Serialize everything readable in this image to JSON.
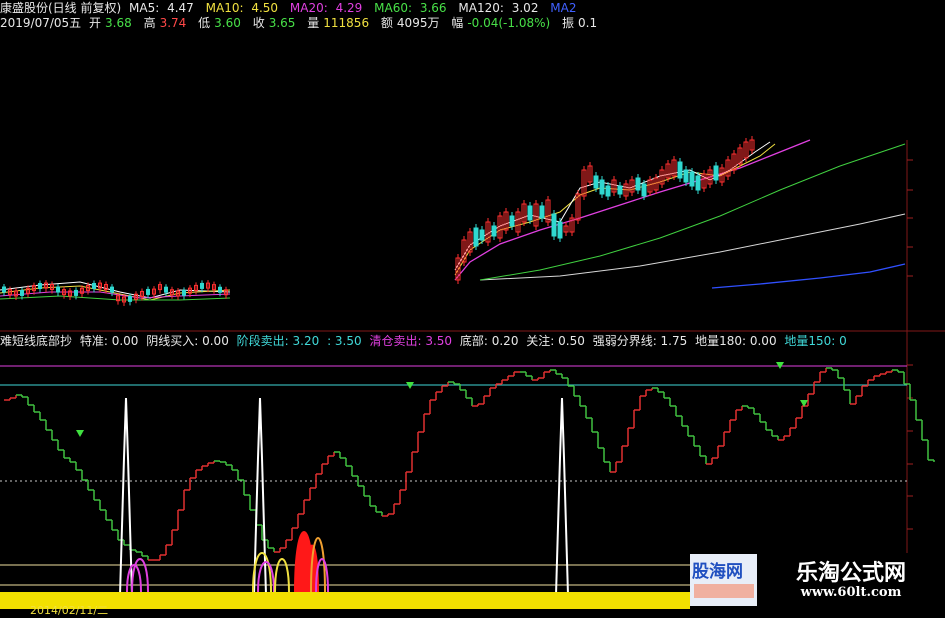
{
  "header": {
    "stock": "康盛股份(日线 前复权)",
    "ma5_label": "MA5:",
    "ma5": "4.47",
    "ma10_label": "MA10:",
    "ma10": "4.50",
    "ma20_label": "MA20:",
    "ma20": "4.29",
    "ma60_label": "MA60:",
    "ma60": "3.66",
    "ma120_label": "MA120:",
    "ma120": "3.02",
    "ma_more": "MA2",
    "date": "2019/07/05五",
    "open_label": "开",
    "open": "3.68",
    "high_label": "高",
    "high": "3.74",
    "low_label": "低",
    "low": "3.60",
    "close_label": "收",
    "close": "3.65",
    "vol_label": "量",
    "vol": "111856",
    "amount_label": "额",
    "amount": "4095万",
    "change_label": "幅",
    "change": "-0.04(-1.08%)",
    "amp_label": "振",
    "amp": "0.1"
  },
  "indicator": {
    "name": "难短线底部抄",
    "t1": "特准: 0.00",
    "t2": "阴线买入: 0.00",
    "t3a": "阶段卖出: 3.20",
    "t3b": ": 3.50",
    "t4": "清仓卖出: 3.50",
    "t5": "底部: 0.20",
    "t6": "关注: 0.50",
    "t7": "强弱分界线: 1.75",
    "t8": "地量180: 0.00",
    "t9": "地量150: 0"
  },
  "footer": {
    "date_label": "2014/02/11/二"
  },
  "watermark": {
    "title": "乐淘公式网",
    "url": "www.60lt.com",
    "logo": "股海网"
  },
  "colors": {
    "bg": "#000000",
    "up": "#ff3030",
    "down": "#30d8d0",
    "ma5": "#ffffff",
    "ma10": "#f0e040",
    "ma20": "#e040e0",
    "ma60": "#40d040",
    "ma120": "#d8d8d8",
    "ma_blue": "#4060ff"
  }
}
